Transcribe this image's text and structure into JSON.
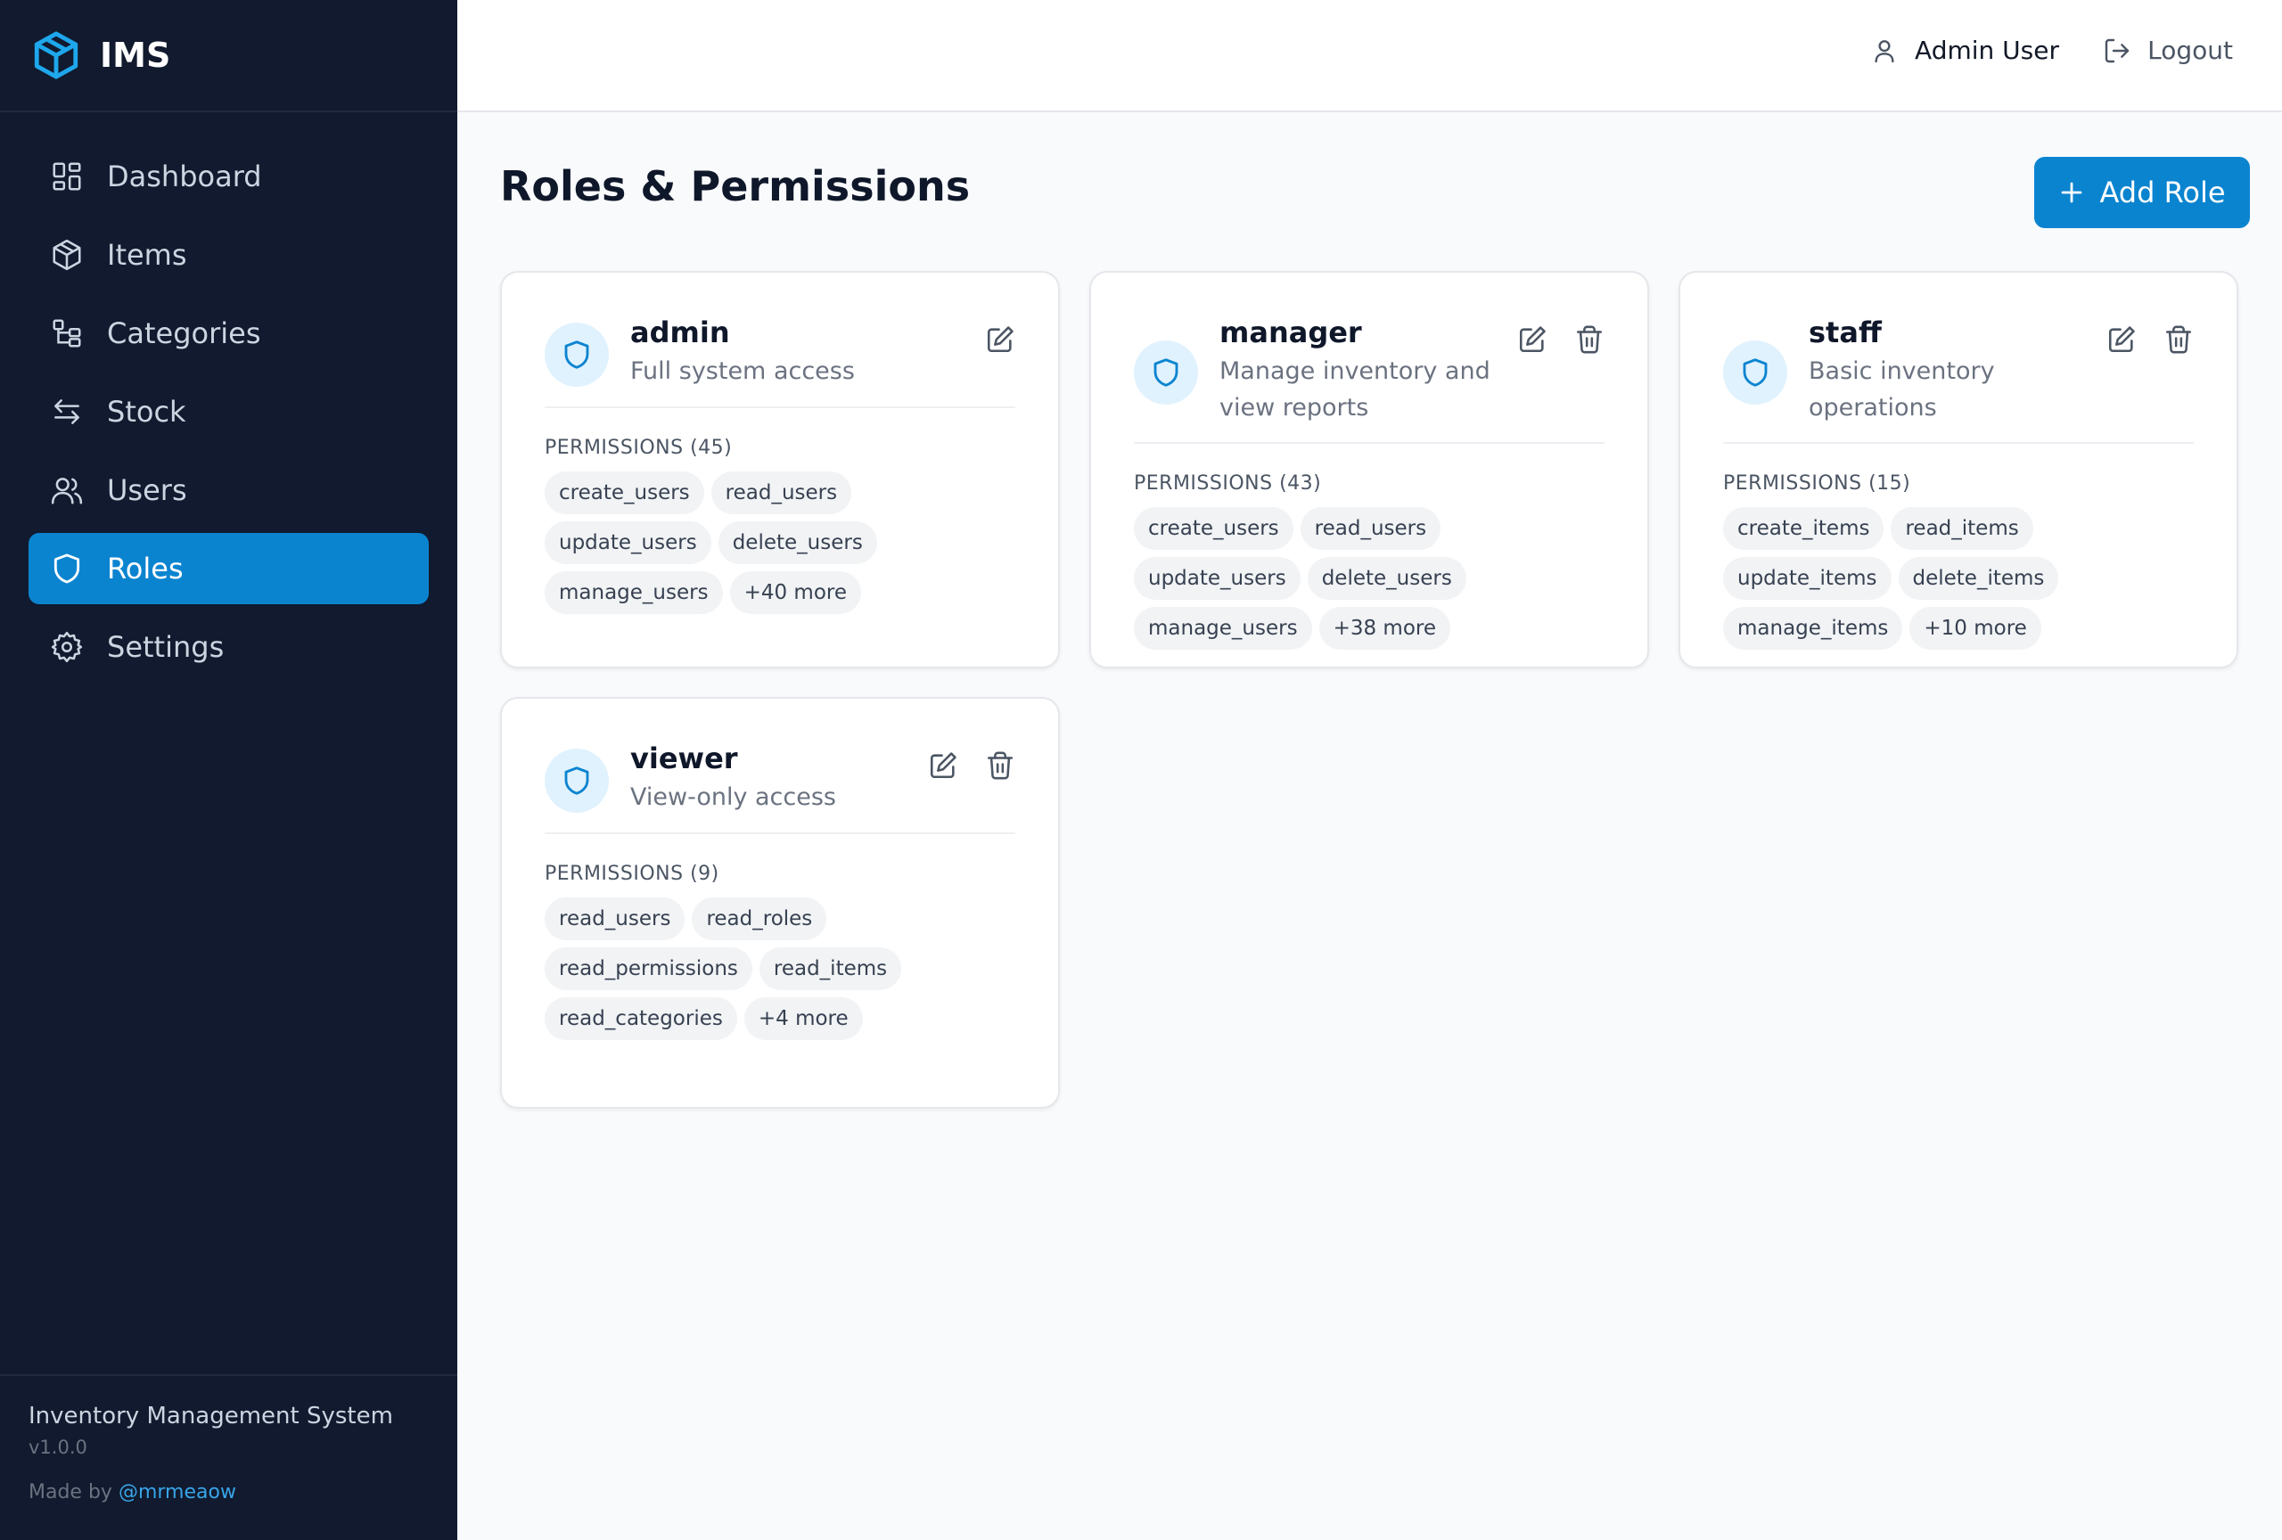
{
  "brand": {
    "name": "IMS",
    "accent": "#0b84d0"
  },
  "sidebar": {
    "items": [
      {
        "label": "Dashboard",
        "icon": "dashboard-icon"
      },
      {
        "label": "Items",
        "icon": "box-icon"
      },
      {
        "label": "Categories",
        "icon": "categories-icon"
      },
      {
        "label": "Stock",
        "icon": "arrows-icon"
      },
      {
        "label": "Users",
        "icon": "users-icon"
      },
      {
        "label": "Roles",
        "icon": "shield-icon",
        "active": true
      },
      {
        "label": "Settings",
        "icon": "gear-icon"
      }
    ],
    "footer": {
      "title": "Inventory Management System",
      "version": "v1.0.0",
      "made_by_prefix": "Made by",
      "made_by_handle": "@mrmeaow"
    }
  },
  "header": {
    "user_name": "Admin User",
    "logout_label": "Logout"
  },
  "main": {
    "title": "Roles & Permissions",
    "add_button_label": "Add Role",
    "roles": [
      {
        "name": "admin",
        "description": "Full system access",
        "permissions_label": "PERMISSIONS (45)",
        "permissions": [
          "create_users",
          "read_users",
          "update_users",
          "delete_users",
          "manage_users",
          "+40 more"
        ],
        "deletable": false
      },
      {
        "name": "manager",
        "description": "Manage inventory and view reports",
        "permissions_label": "PERMISSIONS (43)",
        "permissions": [
          "create_users",
          "read_users",
          "update_users",
          "delete_users",
          "manage_users",
          "+38 more"
        ],
        "deletable": true
      },
      {
        "name": "staff",
        "description": "Basic inventory operations",
        "permissions_label": "PERMISSIONS (15)",
        "permissions": [
          "create_items",
          "read_items",
          "update_items",
          "delete_items",
          "manage_items",
          "+10 more"
        ],
        "deletable": true
      },
      {
        "name": "viewer",
        "description": "View-only access",
        "permissions_label": "PERMISSIONS (9)",
        "permissions": [
          "read_users",
          "read_roles",
          "read_permissions",
          "read_items",
          "read_categories",
          "+4 more"
        ],
        "deletable": true
      }
    ]
  }
}
